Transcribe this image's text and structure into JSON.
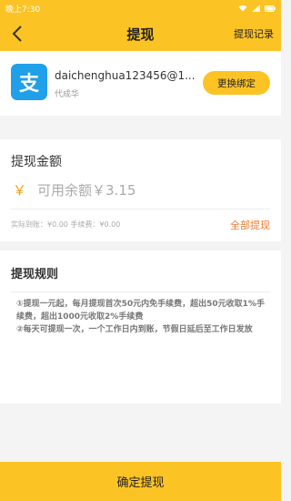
{
  "status_bar": {
    "time": "晚上7:30",
    "icons": [
      "wifi-icon",
      "signal-icon",
      "battery-icon"
    ]
  },
  "header": {
    "title": "提现",
    "right_label": "提现记录",
    "back_icon": "chevron-left-icon"
  },
  "account": {
    "logo_glyph": "支",
    "name": "daichenghua123456@1...",
    "subtitle": "代成华",
    "change_label": "更换绑定"
  },
  "amount": {
    "title": "提现金额",
    "currency_symbol": "￥",
    "available_label": "可用余额￥3.15",
    "fee_line": "实际到账：¥0.00  手续费：¥0.00",
    "withdraw_all": "全部提现"
  },
  "rules": {
    "title": "提现规则",
    "lines": [
      "①提现一元起，每月提现首次50元内免手续费，超出50元收取1%手续费，超出1000元收取2%手续费",
      "②每天可提现一次，一个工作日内到账，节假日延后至工作日发放"
    ]
  },
  "footer": {
    "confirm_label": "确定提现"
  },
  "colors": {
    "accent": "#fcc325",
    "alipay_blue": "#1fa0e8",
    "link_orange": "#f07a2c",
    "yen_orange": "#f39c1a"
  }
}
